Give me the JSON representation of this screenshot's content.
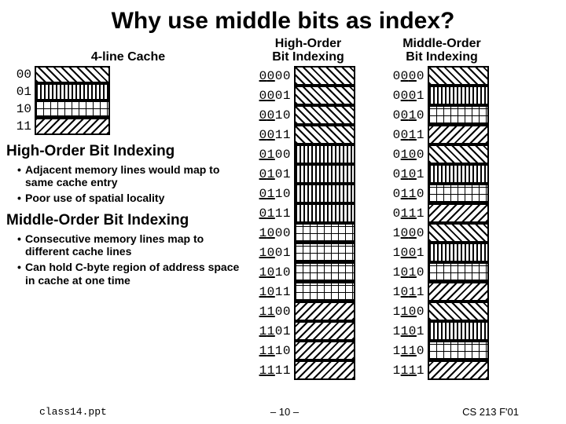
{
  "title": "Why use middle bits as index?",
  "cache": {
    "header": "4-line Cache",
    "rows": [
      {
        "label": "00",
        "pat": 0
      },
      {
        "label": "01",
        "pat": 1
      },
      {
        "label": "10",
        "pat": 2
      },
      {
        "label": "11",
        "pat": 3
      }
    ]
  },
  "sections": [
    {
      "heading": "High-Order Bit Indexing",
      "bullets": [
        "Adjacent memory lines would map to same cache entry",
        "Poor use of spatial locality"
      ]
    },
    {
      "heading": "Middle-Order Bit Indexing",
      "bullets": [
        "Consecutive memory lines map to different cache lines",
        "Can hold C-byte region of address space in cache at one time"
      ]
    }
  ],
  "columns": {
    "high": {
      "header1": "High-Order",
      "header2": "Bit Indexing",
      "rows": [
        {
          "addr": "0000",
          "u": [
            0,
            1
          ],
          "pat": 0
        },
        {
          "addr": "0001",
          "u": [
            0,
            1
          ],
          "pat": 0
        },
        {
          "addr": "0010",
          "u": [
            0,
            1
          ],
          "pat": 0
        },
        {
          "addr": "0011",
          "u": [
            0,
            1
          ],
          "pat": 0
        },
        {
          "addr": "0100",
          "u": [
            0,
            1
          ],
          "pat": 1
        },
        {
          "addr": "0101",
          "u": [
            0,
            1
          ],
          "pat": 1
        },
        {
          "addr": "0110",
          "u": [
            0,
            1
          ],
          "pat": 1
        },
        {
          "addr": "0111",
          "u": [
            0,
            1
          ],
          "pat": 1
        },
        {
          "addr": "1000",
          "u": [
            0,
            1
          ],
          "pat": 2
        },
        {
          "addr": "1001",
          "u": [
            0,
            1
          ],
          "pat": 2
        },
        {
          "addr": "1010",
          "u": [
            0,
            1
          ],
          "pat": 2
        },
        {
          "addr": "1011",
          "u": [
            0,
            1
          ],
          "pat": 2
        },
        {
          "addr": "1100",
          "u": [
            0,
            1
          ],
          "pat": 3
        },
        {
          "addr": "1101",
          "u": [
            0,
            1
          ],
          "pat": 3
        },
        {
          "addr": "1110",
          "u": [
            0,
            1
          ],
          "pat": 3
        },
        {
          "addr": "1111",
          "u": [
            0,
            1
          ],
          "pat": 3
        }
      ]
    },
    "mid": {
      "header1": "Middle-Order",
      "header2": "Bit Indexing",
      "rows": [
        {
          "addr": "0000",
          "u": [
            1,
            2
          ],
          "pat": 0
        },
        {
          "addr": "0001",
          "u": [
            1,
            2
          ],
          "pat": 1
        },
        {
          "addr": "0010",
          "u": [
            1,
            2
          ],
          "pat": 2
        },
        {
          "addr": "0011",
          "u": [
            1,
            2
          ],
          "pat": 3
        },
        {
          "addr": "0100",
          "u": [
            1,
            2
          ],
          "pat": 0
        },
        {
          "addr": "0101",
          "u": [
            1,
            2
          ],
          "pat": 1
        },
        {
          "addr": "0110",
          "u": [
            1,
            2
          ],
          "pat": 2
        },
        {
          "addr": "0111",
          "u": [
            1,
            2
          ],
          "pat": 3
        },
        {
          "addr": "1000",
          "u": [
            1,
            2
          ],
          "pat": 0
        },
        {
          "addr": "1001",
          "u": [
            1,
            2
          ],
          "pat": 1
        },
        {
          "addr": "1010",
          "u": [
            1,
            2
          ],
          "pat": 2
        },
        {
          "addr": "1011",
          "u": [
            1,
            2
          ],
          "pat": 3
        },
        {
          "addr": "1100",
          "u": [
            1,
            2
          ],
          "pat": 0
        },
        {
          "addr": "1101",
          "u": [
            1,
            2
          ],
          "pat": 1
        },
        {
          "addr": "1110",
          "u": [
            1,
            2
          ],
          "pat": 2
        },
        {
          "addr": "1111",
          "u": [
            1,
            2
          ],
          "pat": 3
        }
      ]
    }
  },
  "footer": {
    "file": "class14.ppt",
    "page": "– 10 –",
    "course": "CS 213 F'01"
  }
}
